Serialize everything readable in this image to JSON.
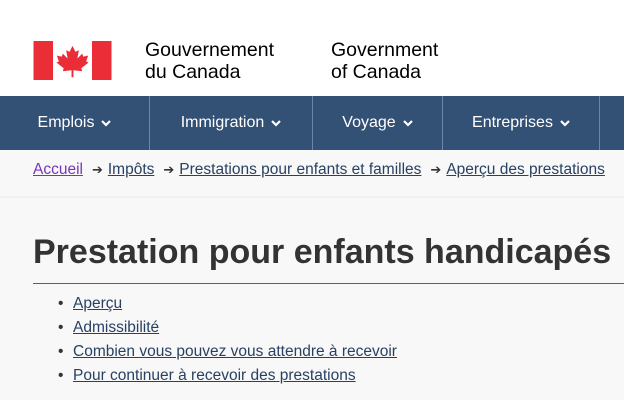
{
  "header": {
    "wordmark_fr_line1": "Gouvernement",
    "wordmark_fr_line2": "du Canada",
    "wordmark_en_line1": "Government",
    "wordmark_en_line2": "of Canada",
    "flag_icon": "canada-flag-icon",
    "colors": {
      "flag_red": "#eb2d37"
    }
  },
  "menu": {
    "items": [
      {
        "label": "Emplois"
      },
      {
        "label": "Immigration"
      },
      {
        "label": "Voyage"
      },
      {
        "label": "Entreprises"
      }
    ],
    "colors": {
      "background": "#335075"
    }
  },
  "breadcrumb": {
    "items": [
      {
        "label": "Accueil"
      },
      {
        "label": "Impôts"
      },
      {
        "label": "Prestations pour enfants et familles"
      },
      {
        "label": "Aperçu des prestations"
      }
    ]
  },
  "page": {
    "title": "Prestation pour enfants handicapés",
    "toc": [
      {
        "label": "Aperçu"
      },
      {
        "label": "Admissibilité"
      },
      {
        "label": "Combien vous pouvez vous attendre à recevoir"
      },
      {
        "label": "Pour continuer à recevoir des prestations"
      }
    ],
    "colors": {
      "title_rule": "#af3c43",
      "link": "#284162",
      "visited_link": "#7834bc"
    }
  }
}
